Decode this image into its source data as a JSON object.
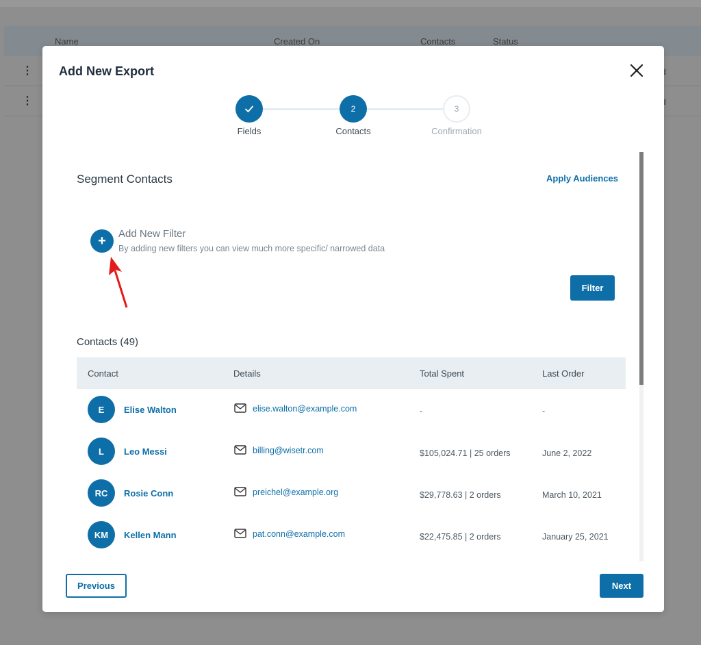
{
  "background": {
    "columns": [
      "Name",
      "Created On",
      "Contacts",
      "Status"
    ],
    "rows": [
      {
        "tail": "d"
      },
      {
        "tail": "d"
      }
    ]
  },
  "modal": {
    "title": "Add New Export",
    "steps": [
      {
        "label": "Fields",
        "number": "",
        "state": "done"
      },
      {
        "label": "Contacts",
        "number": "2",
        "state": "active"
      },
      {
        "label": "Confirmation",
        "number": "3",
        "state": "todo"
      }
    ],
    "segment_title": "Segment Contacts",
    "apply_audiences": "Apply Audiences",
    "add_filter": {
      "title": "Add New Filter",
      "subtitle": "By adding new filters you can view much more specific/ narrowed data"
    },
    "filter_button": "Filter",
    "contacts_title": "Contacts (49)",
    "table": {
      "headers": [
        "Contact",
        "Details",
        "Total Spent",
        "Last Order"
      ],
      "rows": [
        {
          "initials": "E",
          "name": "Elise Walton",
          "email": "elise.walton@example.com",
          "spent": "-",
          "last_order": "-"
        },
        {
          "initials": "L",
          "name": "Leo Messi",
          "email": "billing@wisetr.com",
          "spent": "$105,024.71 | 25 orders",
          "last_order": "June 2, 2022"
        },
        {
          "initials": "RC",
          "name": "Rosie Conn",
          "email": "preichel@example.org",
          "spent": "$29,778.63 | 2 orders",
          "last_order": "March 10, 2021"
        },
        {
          "initials": "KM",
          "name": "Kellen Mann",
          "email": "pat.conn@example.com",
          "spent": "$22,475.85 | 2 orders",
          "last_order": "January 25, 2021"
        }
      ]
    },
    "previous_button": "Previous",
    "next_button": "Next"
  },
  "colors": {
    "accent": "#0e6fa8",
    "overlay": "#8e8e8e",
    "annotation_arrow": "#e31b1b"
  }
}
